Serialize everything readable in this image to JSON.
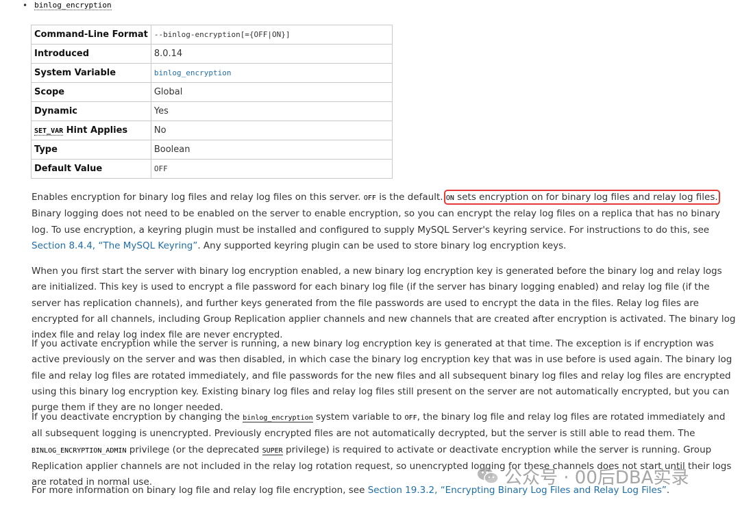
{
  "option": {
    "bullet": "•",
    "name": "binlog_encryption"
  },
  "table": {
    "rows": [
      {
        "key": "Command-Line Format",
        "value": "--binlog-encryption[={OFF|ON}]"
      },
      {
        "key": "Introduced",
        "value": "8.0.14"
      },
      {
        "key": "System Variable",
        "value": "binlog_encryption"
      },
      {
        "key": "Scope",
        "value": "Global"
      },
      {
        "key": "Dynamic",
        "value": "Yes"
      },
      {
        "key_code": "SET_VAR",
        "key_suffix": " Hint Applies",
        "value": "No"
      },
      {
        "key": "Type",
        "value": "Boolean"
      },
      {
        "key": "Default Value",
        "value": "OFF"
      }
    ]
  },
  "paragraphs": {
    "p1": {
      "a": "Enables encryption for binary log files and relay log files on this server. ",
      "code_off": "OFF",
      "b": " is the default. ",
      "hl_code": "ON",
      "hl_text": " sets encryption on for binary log files and relay log files.",
      "c": " Binary logging does not need to be enabled on the server to enable encryption, so you can encrypt the relay log files on a replica that has no binary log. To use encryption, a keyring plugin must be installed and configured to supply MySQL Server's keyring service. For instructions to do this, see ",
      "link": "Section 8.4.4, “The MySQL Keyring”",
      "d": ". Any supported keyring plugin can be used to store binary log encryption keys."
    },
    "p2": "When you first start the server with binary log encryption enabled, a new binary log encryption key is generated before the binary log and relay logs are initialized. This key is used to encrypt a file password for each binary log file (if the server has binary logging enabled) and relay log file (if the server has replication channels), and further keys generated from the file passwords are used to encrypt the data in the files. Relay log files are encrypted for all channels, including Group Replication applier channels and new channels that are created after encryption is activated. The binary log index file and relay log index file are never encrypted.",
    "p3": "If you activate encryption while the server is running, a new binary log encryption key is generated at that time. The exception is if encryption was active previously on the server and was then disabled, in which case the binary log encryption key that was in use before is used again. The binary log file and relay log files are rotated immediately, and file passwords for the new files and all subsequent binary log files and relay log files are encrypted using this binary log encryption key. Existing binary log files and relay log files still present on the server are not automatically encrypted, but you can purge them if they are no longer needed.",
    "p4": {
      "a": "If you deactivate encryption by changing the ",
      "code_var": "binlog_encryption",
      "b": " system variable to ",
      "code_off": "OFF",
      "c": ", the binary log file and relay log files are rotated immediately and all subsequent logging is unencrypted. Previously encrypted files are not automatically decrypted, but the server is still able to read them. The ",
      "code_priv": "BINLOG_ENCRYPTION_ADMIN",
      "d": " privilege (or the deprecated ",
      "code_super": "SUPER",
      "e": " privilege) is required to activate or deactivate encryption while the server is running. Group Replication applier channels are not included in the relay log rotation request, so unencrypted logging for these channels does not start until their logs are rotated in normal use."
    },
    "p5": {
      "a": "For more information on binary log file and relay log file encryption, see ",
      "link": "Section 19.3.2, “Encrypting Binary Log Files and Relay Log Files”",
      "b": "."
    }
  },
  "watermark": {
    "text": "公众号 · 00后DBA实录"
  }
}
